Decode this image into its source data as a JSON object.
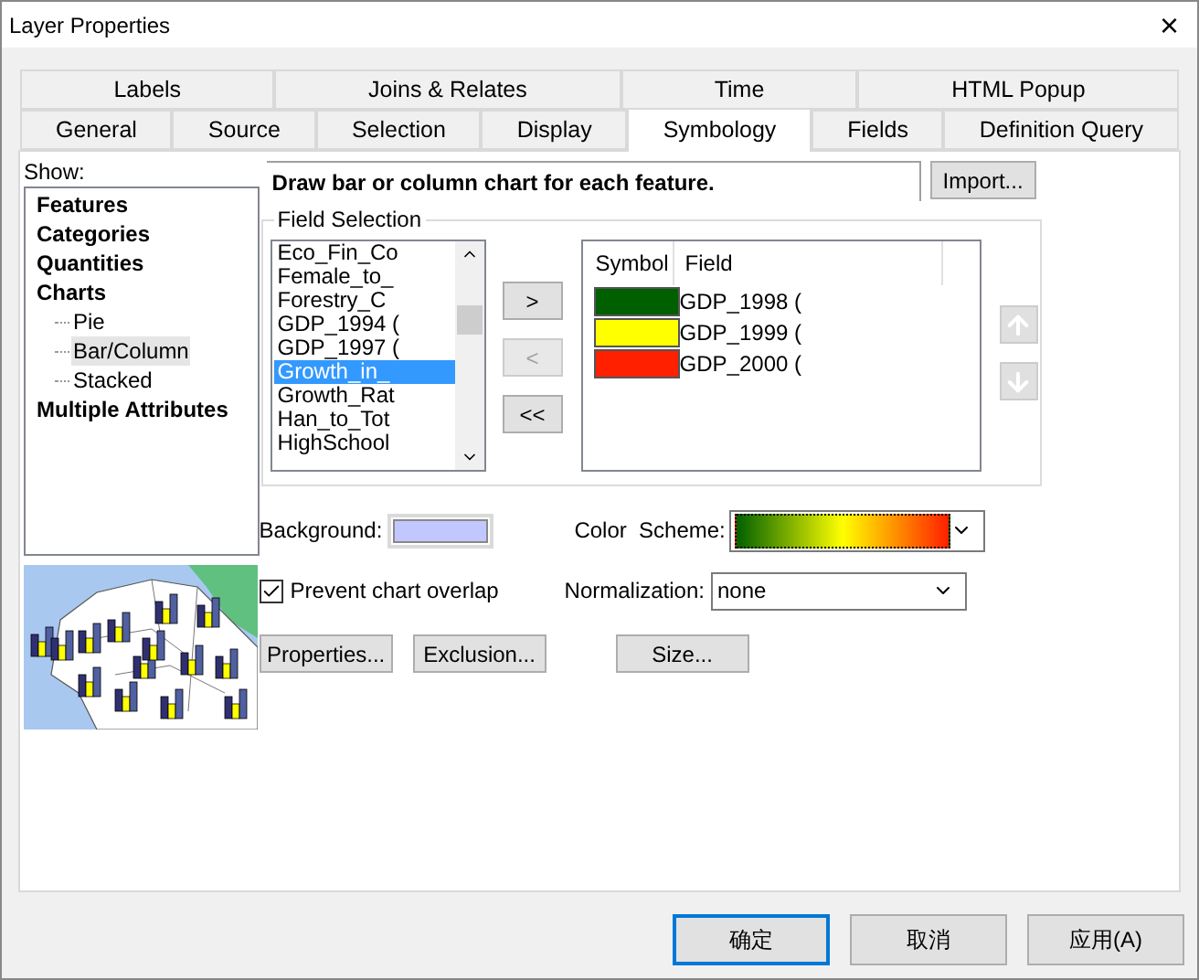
{
  "window": {
    "title": "Layer Properties",
    "close": "×"
  },
  "tab_rows": [
    [
      {
        "label": "Labels",
        "selected": false
      },
      {
        "label": "Joins & Relates",
        "selected": false
      },
      {
        "label": "Time",
        "selected": false
      },
      {
        "label": "HTML Popup",
        "selected": false
      }
    ],
    [
      {
        "label": "General",
        "selected": false
      },
      {
        "label": "Source",
        "selected": false
      },
      {
        "label": "Selection",
        "selected": false
      },
      {
        "label": "Display",
        "selected": false
      },
      {
        "label": "Symbology",
        "selected": true
      },
      {
        "label": "Fields",
        "selected": false
      },
      {
        "label": "Definition Query",
        "selected": false
      }
    ]
  ],
  "show": {
    "label": "Show:",
    "items": [
      {
        "label": "Features",
        "selected": false
      },
      {
        "label": "Categories",
        "selected": false
      },
      {
        "label": "Quantities",
        "selected": false
      },
      {
        "label": "Charts",
        "selected": false,
        "children": [
          {
            "label": "Pie",
            "selected": false
          },
          {
            "label": "Bar/Column",
            "selected": true
          },
          {
            "label": "Stacked",
            "selected": false
          }
        ]
      },
      {
        "label": "Multiple Attributes",
        "selected": false
      }
    ]
  },
  "description": "Draw bar or column chart for each feature.",
  "import_button": "Import...",
  "field_selection": {
    "title": "Field Selection",
    "fields": [
      {
        "label": "Eco_Fin_Co",
        "selected": false
      },
      {
        "label": "Female_to_",
        "selected": false
      },
      {
        "label": "Forestry_C",
        "selected": false
      },
      {
        "label": "GDP_1994 (",
        "selected": false
      },
      {
        "label": "GDP_1997 (",
        "selected": false
      },
      {
        "label": "Growth_in_",
        "selected": true
      },
      {
        "label": "Growth_Rat",
        "selected": false
      },
      {
        "label": "Han_to_Tot",
        "selected": false
      },
      {
        "label": "HighSchool",
        "selected": false
      }
    ],
    "move_buttons": [
      {
        "label": ">",
        "disabled": false
      },
      {
        "label": "<",
        "disabled": true
      },
      {
        "label": "<<",
        "disabled": false
      }
    ],
    "columns": [
      "Symbol",
      "Field"
    ],
    "rows": [
      {
        "field": "GDP_1998 (",
        "color": "#006000"
      },
      {
        "field": "GDP_1999 (",
        "color": "#ffff00"
      },
      {
        "field": "GDP_2000 (",
        "color": "#ff2000"
      }
    ]
  },
  "background": {
    "label": "Background:",
    "color": "#c0c8ff"
  },
  "color_scheme": {
    "label": "Color  Scheme:"
  },
  "prevent_overlap": {
    "label": "Prevent chart overlap",
    "checked": true
  },
  "normalization": {
    "label": "Normalization:",
    "value": "none"
  },
  "buttons": [
    "Properties...",
    "Exclusion...",
    "Size..."
  ],
  "footer_buttons": [
    {
      "label": "确定",
      "default": true
    },
    {
      "label": "取消",
      "default": false
    },
    {
      "label": "应用(A)",
      "default": false
    }
  ]
}
